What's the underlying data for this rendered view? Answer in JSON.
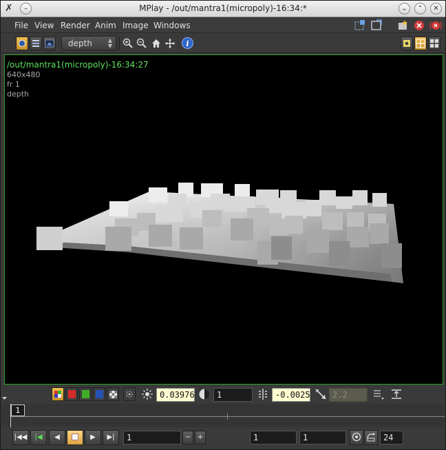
{
  "window": {
    "title": "MPlay - /out/mantra1(micropoly)-16:34:*",
    "app_icon": "houdini-x-icon"
  },
  "menu": {
    "items": [
      "File",
      "View",
      "Render",
      "Anim",
      "Image",
      "Windows"
    ]
  },
  "toolbar": {
    "plane": "depth",
    "icons": [
      "color-mode-icon",
      "channel-list-icon",
      "display-options-icon",
      "zoom-in-icon",
      "zoom-out-icon",
      "home-icon",
      "frame-icon",
      "info-icon"
    ]
  },
  "viewport": {
    "path": "/out/mantra1(micropoly)-16:34:27",
    "resolution": "640x480",
    "frame": "fr 1",
    "plane": "depth"
  },
  "controls": {
    "gamma_value": "0.03976",
    "contrast_value": "1",
    "offset_value": "-0.0025",
    "lut_value": "2.2"
  },
  "timeline": {
    "current_frame": "1"
  },
  "playback": {
    "frame_field": "1",
    "start_frame": "1",
    "end_frame": "1",
    "fps": "24"
  },
  "colors": {
    "accent": "#f2c050",
    "viewport_border": "#2fa12f",
    "path_text": "#5ee05e"
  }
}
